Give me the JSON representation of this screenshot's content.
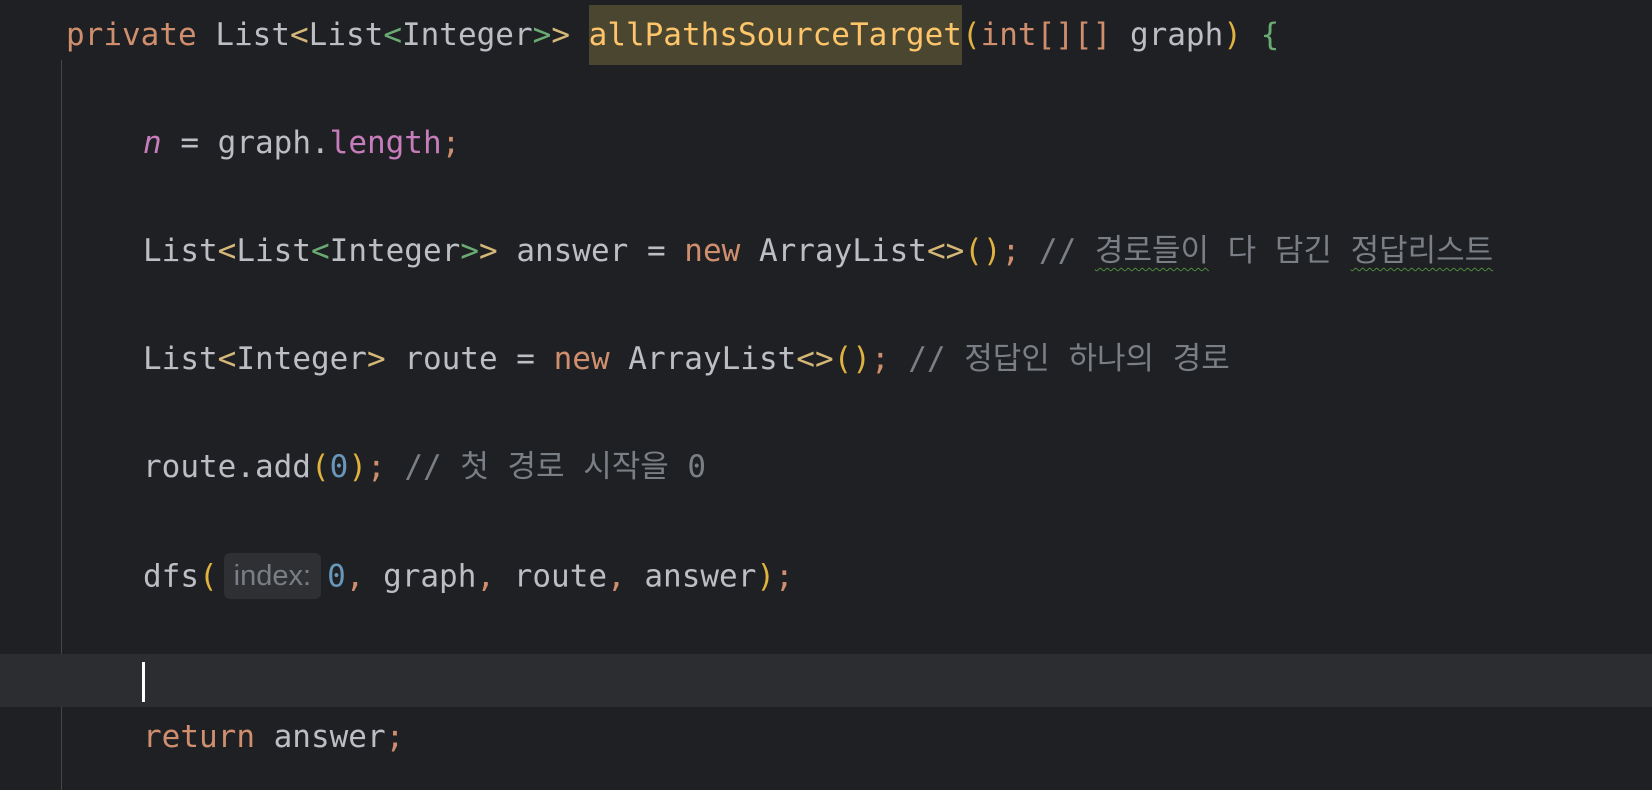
{
  "code": {
    "line1": {
      "kw_private": "private",
      "type": "List<List<Integer>>",
      "method": "allPathsSourceTarget",
      "paren_open": "(",
      "param_type": "int[][]",
      "param_name": "graph",
      "paren_close": ")",
      "brace": "{"
    },
    "line2": {
      "var": "n",
      "assign": " = graph.",
      "field": "length",
      "semi": ";"
    },
    "line3": {
      "decl": "List<List<Integer>> answer = ",
      "kw_new": "new",
      "ctor": " ArrayList",
      "diamond": "<>",
      "parens": "()",
      "semi": ";",
      "comment_prefix": " // ",
      "comment_w1": "경로들이",
      "comment_mid": " 다 담긴 ",
      "comment_w2": "정답리스트"
    },
    "line4": {
      "decl": "List<Integer> route = ",
      "kw_new": "new",
      "ctor": " ArrayList",
      "diamond": "<>",
      "parens": "()",
      "semi": ";",
      "comment": " // 정답인 하나의 경로"
    },
    "line5": {
      "call": "route.add",
      "paren_open": "(",
      "arg": "0",
      "paren_close": ")",
      "semi": ";",
      "comment": " // 첫 경로 시작을 0"
    },
    "line6": {
      "call": "dfs",
      "paren_open": "(",
      "hint": "index:",
      "arg0": "0",
      "comma1": ",",
      "arg1": " graph",
      "comma2": ",",
      "arg2": " route",
      "comma3": ",",
      "arg3": " answer",
      "paren_close": ")",
      "semi": ";"
    },
    "line8": {
      "kw_return": "return",
      "value": " answer",
      "semi": ";"
    }
  },
  "colors": {
    "background": "#1f2023",
    "current_line": "#2b2d30",
    "keyword": "#cf8e6d",
    "identifier": "#bcbec4",
    "method_highlight": "#fec56a",
    "field": "#c77dbb",
    "number": "#6897bb",
    "comment": "#7a7e85"
  }
}
